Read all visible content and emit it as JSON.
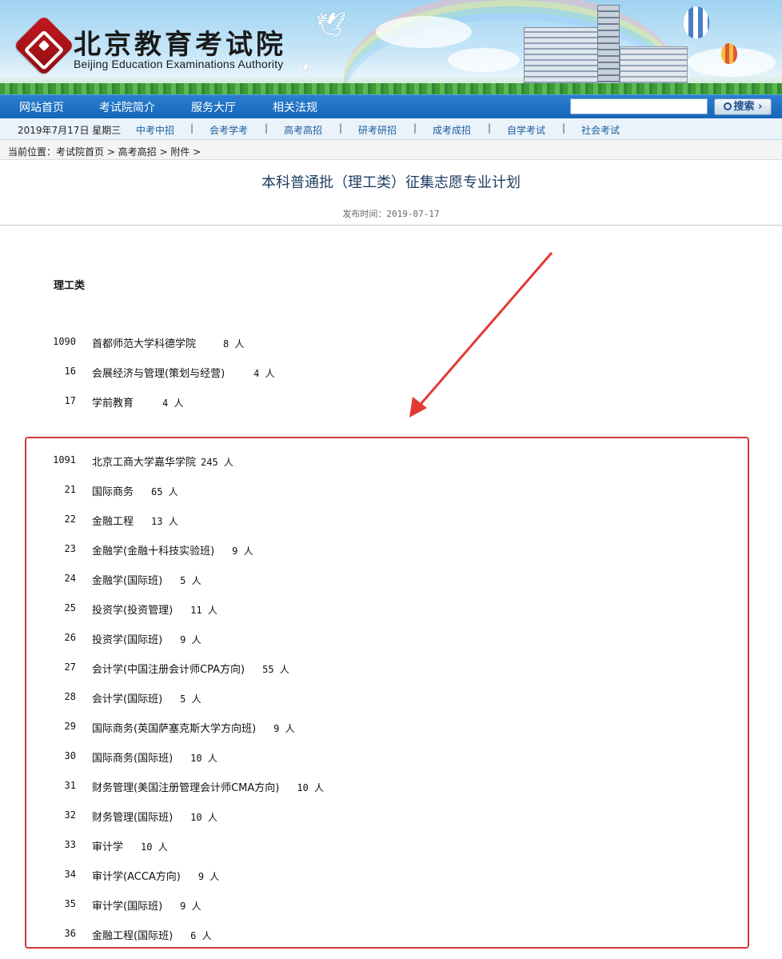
{
  "header": {
    "logo_cn": "北京教育考试院",
    "logo_en": "Beijing Education Examinations Authority"
  },
  "main_nav": {
    "items": [
      "网站首页",
      "考试院简介",
      "服务大厅",
      "相关法规"
    ],
    "search_placeholder": "",
    "search_label": "搜索"
  },
  "sub_nav": {
    "date": "2019年7月17日 星期三",
    "items": [
      "中考中招",
      "会考学考",
      "高考高招",
      "研考研招",
      "成考成招",
      "自学考试",
      "社会考试"
    ]
  },
  "breadcrumb": {
    "text": "当前位置：考试院首页 > 高考高招 > 附件 >"
  },
  "article": {
    "title": "本科普通批（理工类）征集志愿专业计划",
    "pubtime_label": "发布时间：",
    "pubtime_value": "2019-07-17",
    "section": "理工类",
    "school1": {
      "code": "1090",
      "name": "首都师范大学科德学院",
      "count": "8 人",
      "majors": [
        {
          "code": "16",
          "name": "会展经济与管理(策划与经营)",
          "count": "4 人"
        },
        {
          "code": "17",
          "name": "学前教育",
          "count": "4 人"
        }
      ]
    },
    "school2": {
      "code": "1091",
      "name": "北京工商大学嘉华学院",
      "count": "245 人",
      "majors": [
        {
          "code": "21",
          "name": "国际商务",
          "count": "65 人"
        },
        {
          "code": "22",
          "name": "金融工程",
          "count": "13 人"
        },
        {
          "code": "23",
          "name": "金融学(金融十科技实验班)",
          "count": "9 人"
        },
        {
          "code": "24",
          "name": "金融学(国际班)",
          "count": "5 人"
        },
        {
          "code": "25",
          "name": "投资学(投资管理)",
          "count": "11 人"
        },
        {
          "code": "26",
          "name": "投资学(国际班)",
          "count": "9 人"
        },
        {
          "code": "27",
          "name": "会计学(中国注册会计师CPA方向)",
          "count": "55 人"
        },
        {
          "code": "28",
          "name": "会计学(国际班)",
          "count": "5 人"
        },
        {
          "code": "29",
          "name": "国际商务(英国萨塞克斯大学方向班)",
          "count": "9 人"
        },
        {
          "code": "30",
          "name": "国际商务(国际班)",
          "count": "10 人"
        },
        {
          "code": "31",
          "name": "财务管理(美国注册管理会计师CMA方向)",
          "count": "10 人"
        },
        {
          "code": "32",
          "name": "财务管理(国际班)",
          "count": "10 人"
        },
        {
          "code": "33",
          "name": "审计学",
          "count": "10 人"
        },
        {
          "code": "34",
          "name": "审计学(ACCA方向)",
          "count": "9 人"
        },
        {
          "code": "35",
          "name": "审计学(国际班)",
          "count": "9 人"
        },
        {
          "code": "36",
          "name": "金融工程(国际班)",
          "count": "6 人"
        }
      ]
    }
  },
  "colors": {
    "nav_blue": "#1566b8",
    "subnav_link": "#1b5e9e",
    "title_blue": "#1f3e63",
    "annotation_red": "#d23a3a"
  }
}
